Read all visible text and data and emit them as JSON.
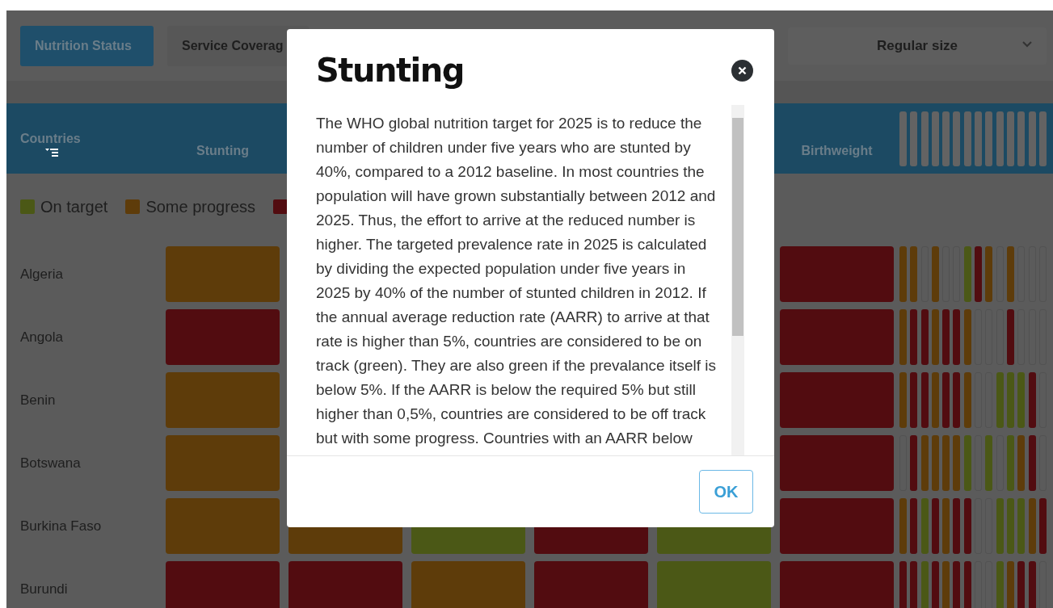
{
  "tabs": [
    {
      "label": "Nutrition Status",
      "selected": true
    },
    {
      "label": "Service Coverag",
      "selected": false
    }
  ],
  "size_dropdown": {
    "value": "Regular size"
  },
  "table": {
    "columns": [
      {
        "label": "Countries"
      },
      {
        "label": "Stunting"
      },
      {
        "label": "Birthweight"
      }
    ]
  },
  "legend": [
    {
      "label": "On target",
      "color": "#4b5816"
    },
    {
      "label": "Some progress",
      "color": "#5e3c0a"
    },
    {
      "color": "#520c10"
    }
  ],
  "rows": [
    {
      "country": "Algeria",
      "cells": [
        {
          "color": "#5e3c0a"
        },
        null,
        null,
        null,
        null,
        {
          "color": "#520c10"
        }
      ],
      "indicators": [
        {
          "color": "#5e3c0a"
        },
        {
          "color": "#5e3c0a"
        },
        {
          "filled": false
        },
        {
          "color": "#5e3c0a"
        },
        {
          "filled": false
        },
        {
          "filled": false
        },
        {
          "color": "#4b5816"
        },
        {
          "color": "#520c10"
        },
        {
          "color": "#5e3c0a"
        },
        {
          "filled": false
        },
        {
          "color": "#5e3c0a"
        },
        {
          "filled": false
        },
        {
          "filled": false
        },
        {
          "filled": false
        }
      ]
    },
    {
      "country": "Angola",
      "cells": [
        {
          "color": "#520c10"
        },
        null,
        null,
        null,
        null,
        {
          "color": "#520c10"
        }
      ],
      "indicators": [
        {
          "color": "#5e3c0a"
        },
        {
          "color": "#520c10"
        },
        {
          "color": "#520c10"
        },
        {
          "color": "#5e3c0a"
        },
        {
          "color": "#520c10"
        },
        {
          "color": "#520c10"
        },
        {
          "color": "#5e3c0a"
        },
        {
          "filled": false
        },
        {
          "filled": false
        },
        {
          "filled": false
        },
        {
          "color": "#520c10"
        },
        {
          "filled": false
        },
        {
          "filled": false
        },
        {
          "filled": false
        }
      ]
    },
    {
      "country": "Benin",
      "cells": [
        {
          "color": "#5e3c0a"
        },
        null,
        null,
        null,
        null,
        {
          "color": "#520c10"
        }
      ],
      "indicators": [
        {
          "color": "#5e3c0a"
        },
        {
          "color": "#520c10"
        },
        {
          "color": "#520c10"
        },
        {
          "color": "#5e3c0a"
        },
        {
          "color": "#520c10"
        },
        {
          "color": "#520c10"
        },
        {
          "color": "#5e3c0a"
        },
        {
          "filled": false
        },
        {
          "filled": false
        },
        {
          "color": "#4b5816"
        },
        {
          "color": "#4b5816"
        },
        {
          "color": "#4b5816"
        },
        {
          "color": "#520c10"
        },
        {
          "filled": false
        }
      ]
    },
    {
      "country": "Botswana",
      "cells": [
        {
          "color": "#5e3c0a"
        },
        null,
        null,
        null,
        null,
        {
          "color": "#520c10"
        }
      ],
      "indicators": [
        {
          "filled": false
        },
        {
          "color": "#520c10"
        },
        {
          "color": "#5e3c0a"
        },
        {
          "color": "#5e3c0a"
        },
        {
          "color": "#5e3c0a"
        },
        {
          "color": "#5e3c0a"
        },
        {
          "color": "#4b5816"
        },
        {
          "filled": false
        },
        {
          "color": "#4b5816"
        },
        {
          "filled": false
        },
        {
          "color": "#4b5816"
        },
        {
          "color": "#5e3c0a"
        },
        {
          "color": "#520c10"
        },
        {
          "filled": false
        }
      ]
    },
    {
      "country": "Burkina Faso",
      "cells": [
        {
          "color": "#5e3c0a"
        },
        {
          "color": "#5e3c0a"
        },
        {
          "color": "#4b5816"
        },
        {
          "color": "#520c10"
        },
        {
          "color": "#4b5816"
        },
        {
          "color": "#520c10"
        }
      ],
      "indicators": [
        {
          "color": "#5e3c0a"
        },
        {
          "color": "#520c10"
        },
        {
          "color": "#4b5816"
        },
        {
          "color": "#520c10"
        },
        {
          "color": "#5e3c0a"
        },
        {
          "color": "#520c10"
        },
        {
          "color": "#520c10"
        },
        {
          "filled": false
        },
        {
          "filled": false
        },
        {
          "color": "#4b5816"
        },
        {
          "color": "#4b5816"
        },
        {
          "color": "#4b5816"
        },
        {
          "color": "#5e3c0a"
        },
        {
          "color": "#520c10"
        }
      ]
    },
    {
      "country": "Burundi",
      "cells": [
        {
          "color": "#520c10"
        },
        {
          "color": "#520c10"
        },
        {
          "color": "#5e3c0a"
        },
        {
          "color": "#520c10"
        },
        {
          "color": "#4b5816"
        },
        {
          "color": "#520c10"
        }
      ],
      "indicators": [
        {
          "color": "#520c10"
        },
        {
          "color": "#520c10"
        },
        {
          "color": "#4b5816"
        },
        {
          "color": "#520c10"
        },
        {
          "color": "#5e3c0a"
        },
        {
          "color": "#520c10"
        },
        {
          "color": "#520c10"
        },
        {
          "filled": false
        },
        {
          "filled": false
        },
        {
          "color": "#4b5816"
        },
        {
          "color": "#5e3c0a"
        },
        {
          "color": "#520c10"
        },
        {
          "color": "#520c10"
        },
        {
          "filled": false
        }
      ]
    }
  ],
  "modal": {
    "title": "Stunting",
    "body": "The WHO global nutrition target for 2025 is to reduce the number of children under five years who are stunted by 40%, compared to a 2012 baseline. In most countries the population will have grown substantially between 2012 and 2025. Thus, the effort to arrive at the reduced number is higher. The targeted prevalence rate in 2025 is calculated by dividing the expected population under five years in 2025 by 40% of the number of stunted children in 2012. If the annual average reduction rate (AARR) to arrive at that rate is higher than 5%, countries are considered to be on track (green). They are also green if the prevalance itself is below 5%. If the AARR is below the required 5% but still higher than 0,5%, countries are considered to be off track but with some progress. Countries with an AARR below",
    "ok_button": "OK"
  }
}
